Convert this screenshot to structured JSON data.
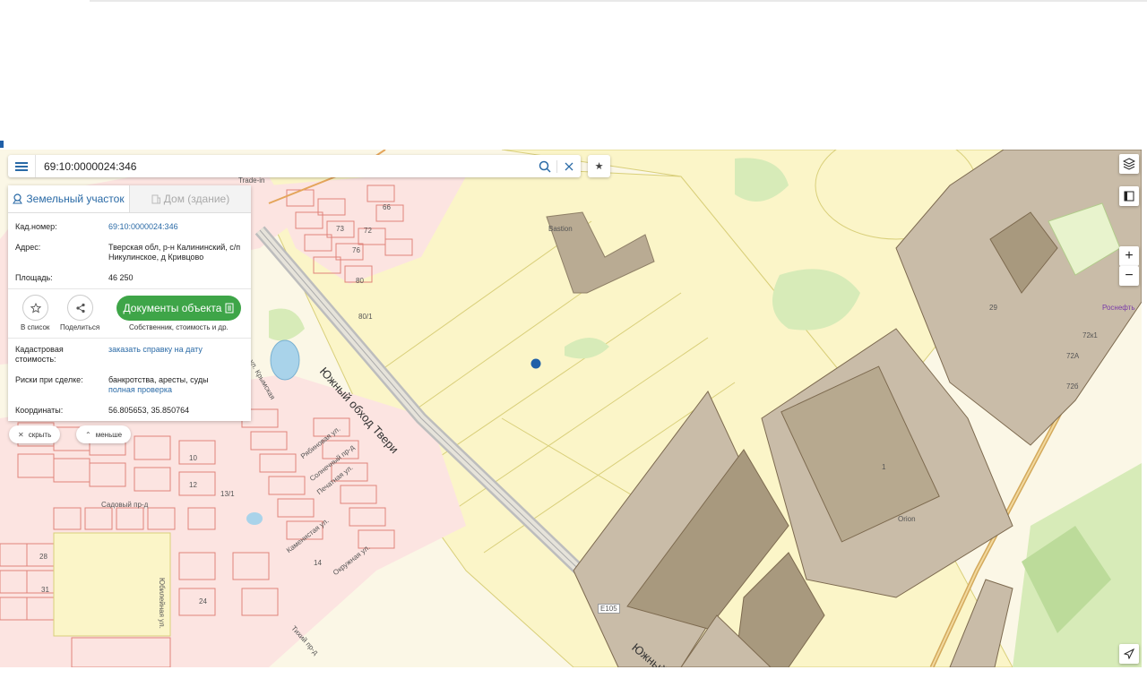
{
  "search": {
    "query": "69:10:0000024:346"
  },
  "tabs": [
    {
      "label": "Земельный участок",
      "icon": "land-icon"
    },
    {
      "label": "Дом (здание)",
      "icon": "building-icon"
    }
  ],
  "details": {
    "kad_label": "Кад.номер:",
    "kad_value": "69:10:0000024:346",
    "address_label": "Адрес:",
    "address_value": "Тверская обл, р-н Калининский, с/п Никулинское, д Кривцово",
    "area_label": "Площадь:",
    "area_value": "46 250",
    "cost_label": "Кадастровая стоимость:",
    "cost_link": "заказать справку на дату",
    "risks_label": "Риски при сделке:",
    "risks_value": "банкротства, аресты, суды",
    "risks_link": "полная проверка",
    "coords_label": "Координаты:",
    "coords_value": "56.805653, 35.850764"
  },
  "actions": {
    "to_list": "В список",
    "share": "Поделиться",
    "docs_button": "Документы объекта",
    "docs_caption": "Собственник, стоимость и др."
  },
  "pills": {
    "hide": "скрыть",
    "less": "меньше"
  },
  "map_labels": {
    "road_main": "Южный обход Твери",
    "road_main_2": "Южный об",
    "bastion": "Bastion",
    "orion": "Orion",
    "rosneft": "Роснефть",
    "tradein": "Trade-in",
    "e105": "E105",
    "sadoviy": "Садовый пр-д",
    "yubileynaya": "Юбилейная ул.",
    "ryabinovaya": "Рябиновая ул.",
    "solnechniy": "Солнечный пр-д",
    "pechatnaya": "Печатная ул.",
    "kamennaya": "Каменистая ул.",
    "okruzhnaya": "Окружная ул.",
    "tikhiy": "Тихий пр-д",
    "krymskaya": "ул. Крымская",
    "num_66": "66",
    "num_72": "72",
    "num_73": "73",
    "num_76": "76",
    "num_80": "80",
    "num_801": "80/1",
    "num_29": "29",
    "num_72k1": "72к1",
    "num_72a": "72А",
    "num_726": "72б",
    "num_1": "1",
    "num_10": "10",
    "num_12": "12",
    "num_131": "13/1",
    "num_28": "28",
    "num_31": "31",
    "num_24": "24",
    "num_14": "14"
  },
  "colors": {
    "accent": "#2a6aa6",
    "docs_green": "#3ea548",
    "parcel_yellow": "#fbf5c8",
    "parcel_red": "#e0837a",
    "industrial": "#c9bca8",
    "industrial_dark": "#a8997e",
    "road": "#c8c8c8",
    "green": "#cfe6b0",
    "marker": "#1f5fa8"
  }
}
